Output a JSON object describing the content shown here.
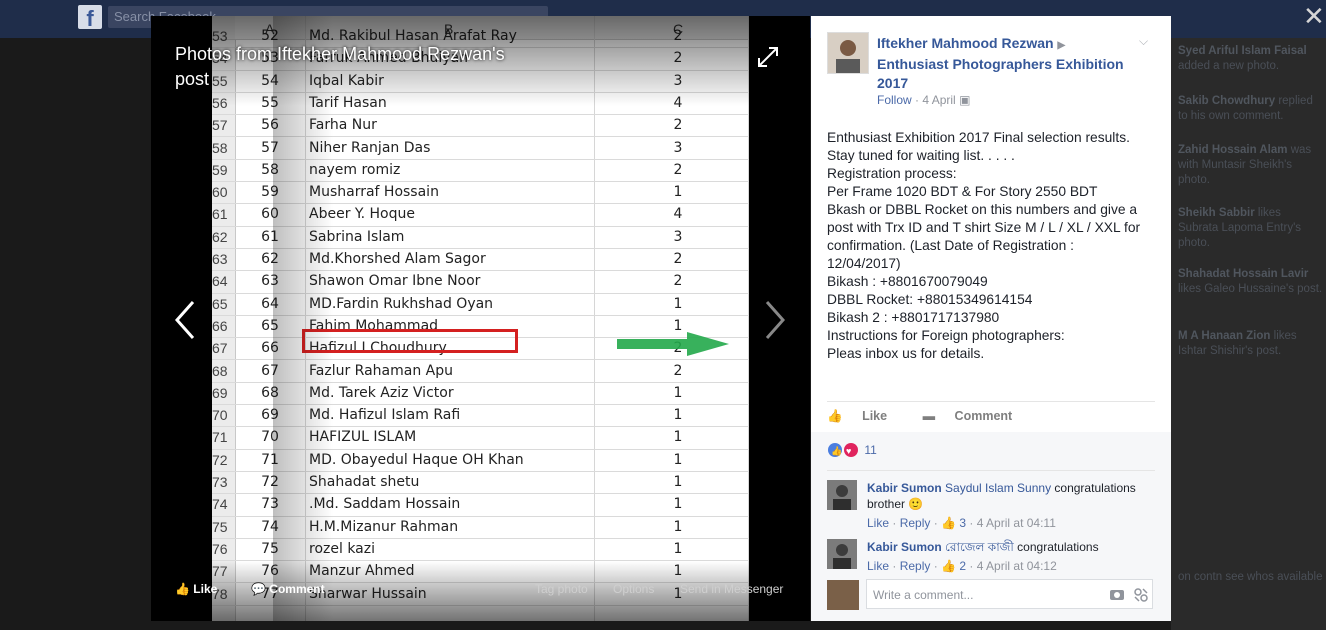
{
  "topbar": {
    "logo": "f",
    "search_placeholder": "Search Facebook"
  },
  "close_label": "✕",
  "background_feed": [
    {
      "name": "Syed Ariful Islam Faisal",
      "text": "added a new photo."
    },
    {
      "name": "Sakib Chowdhury",
      "text": "replied to his own comment."
    },
    {
      "name": "Zahid Hossain Alam",
      "text": "was with Muntasir Sheikh's photo."
    },
    {
      "name": "Sheikh Sabbir",
      "text": "likes Subrata Lapoma Entry's photo."
    },
    {
      "name": "Shahadat Hossain Lavir",
      "text": "likes Galeo Hussaine's post."
    },
    {
      "name": "M A Hanaan Zion",
      "text": "likes Ishtar Shishir's post."
    },
    {
      "name": "",
      "text": "on contn see whos available"
    }
  ],
  "viewer": {
    "title": "Photos from Iftekher Mahmood Rezwan's post",
    "actions": {
      "like": "Like",
      "comment": "Comment",
      "tag": "Tag photo",
      "options": "Options",
      "send": "Send in Messenger"
    }
  },
  "spreadsheet": {
    "columns": [
      "A",
      "B",
      "C"
    ],
    "rows": [
      {
        "rn": "53",
        "a": "52",
        "b": "Md. Rakibul Hasan Arafat Ray",
        "c": "2"
      },
      {
        "rn": "54",
        "a": "53",
        "b": "Farruk Ahmed Bhuiyan",
        "c": "2"
      },
      {
        "rn": "55",
        "a": "54",
        "b": "Iqbal Kabir",
        "c": "3"
      },
      {
        "rn": "56",
        "a": "55",
        "b": "Tarif Hasan",
        "c": "4"
      },
      {
        "rn": "57",
        "a": "56",
        "b": "Farha Nur",
        "c": "2"
      },
      {
        "rn": "58",
        "a": "57",
        "b": "Niher Ranjan Das",
        "c": "3"
      },
      {
        "rn": "59",
        "a": "58",
        "b": "nayem romiz",
        "c": "2"
      },
      {
        "rn": "60",
        "a": "59",
        "b": "Musharraf Hossain",
        "c": "1"
      },
      {
        "rn": "61",
        "a": "60",
        "b": "Abeer Y. Hoque",
        "c": "4"
      },
      {
        "rn": "62",
        "a": "61",
        "b": "Sabrina Islam",
        "c": "3"
      },
      {
        "rn": "63",
        "a": "62",
        "b": "Md.Khorshed Alam Sagor",
        "c": "2"
      },
      {
        "rn": "64",
        "a": "63",
        "b": "Shawon Omar Ibne Noor",
        "c": "2"
      },
      {
        "rn": "65",
        "a": "64",
        "b": "MD.Fardin Rukhshad Oyan",
        "c": "1"
      },
      {
        "rn": "66",
        "a": "65",
        "b": "Fahim Mohammad",
        "c": "1"
      },
      {
        "rn": "67",
        "a": "66",
        "b": "Hafizul I Choudhury",
        "c": "2"
      },
      {
        "rn": "68",
        "a": "67",
        "b": "Fazlur Rahaman Apu",
        "c": "2"
      },
      {
        "rn": "69",
        "a": "68",
        "b": "Md. Tarek Aziz Victor",
        "c": "1"
      },
      {
        "rn": "70",
        "a": "69",
        "b": "Md. Hafizul Islam Rafi",
        "c": "1"
      },
      {
        "rn": "71",
        "a": "70",
        "b": "HAFIZUL ISLAM",
        "c": "1"
      },
      {
        "rn": "72",
        "a": "71",
        "b": "MD. Obayedul Haque OH Khan",
        "c": "1"
      },
      {
        "rn": "73",
        "a": "72",
        "b": "Shahadat shetu",
        "c": "1"
      },
      {
        "rn": "74",
        "a": "73",
        "b": ".Md. Saddam Hossain",
        "c": "1"
      },
      {
        "rn": "75",
        "a": "74",
        "b": "H.M.Mizanur Rahman",
        "c": "1"
      },
      {
        "rn": "76",
        "a": "75",
        "b": "rozel kazi",
        "c": "1"
      },
      {
        "rn": "77",
        "a": "76",
        "b": "Manzur Ahmed",
        "c": "1"
      },
      {
        "rn": "78",
        "a": "77",
        "b": "Sharwar Hussain",
        "c": "1"
      }
    ],
    "highlight_color": "#d42020",
    "arrow_color": "#22a84a"
  },
  "post": {
    "author": "Iftekher Mahmood Rezwan",
    "group": "Enthusiast Photographers Exhibition 2017",
    "follow": "Follow",
    "date": "4 April",
    "body": [
      "Enthusiast Exhibition 2017 Final selection results.",
      "Stay tuned for waiting list. . . . .",
      "Registration process:",
      "Per Frame 1020 BDT & For Story 2550 BDT",
      "Bkash or DBBL Rocket on this numbers and give a",
      "post with Trx ID and T shirt Size M / L / XL / XXL for",
      "confirmation. (Last Date of Registration :",
      "12/04/2017)",
      "Bikash : +8801670079049",
      "DBBL Rocket: +88015349614154",
      "Bikash 2 : +8801717137980",
      "Instructions for Foreign photographers:",
      "Pleas inbox us for details."
    ],
    "like_label": "Like",
    "comment_label": "Comment",
    "reaction_count": "11"
  },
  "comments": [
    {
      "name": "Kabir Sumon",
      "tag": "Saydul Islam Sunny",
      "text": " congratulations brother ",
      "emoji": "🙂",
      "like": "Like",
      "reply": "Reply",
      "likes": "3",
      "time": "4 April at 04:11"
    },
    {
      "name": "Kabir Sumon",
      "tag": "রোজেল কাজী",
      "text": " congratulations",
      "emoji": "",
      "like": "Like",
      "reply": "Reply",
      "likes": "2",
      "time": "4 April at 04:12"
    }
  ],
  "write_comment_placeholder": "Write a comment...",
  "colors": {
    "brand": "#3b5998",
    "link": "#365899",
    "meta": "#90949c"
  }
}
